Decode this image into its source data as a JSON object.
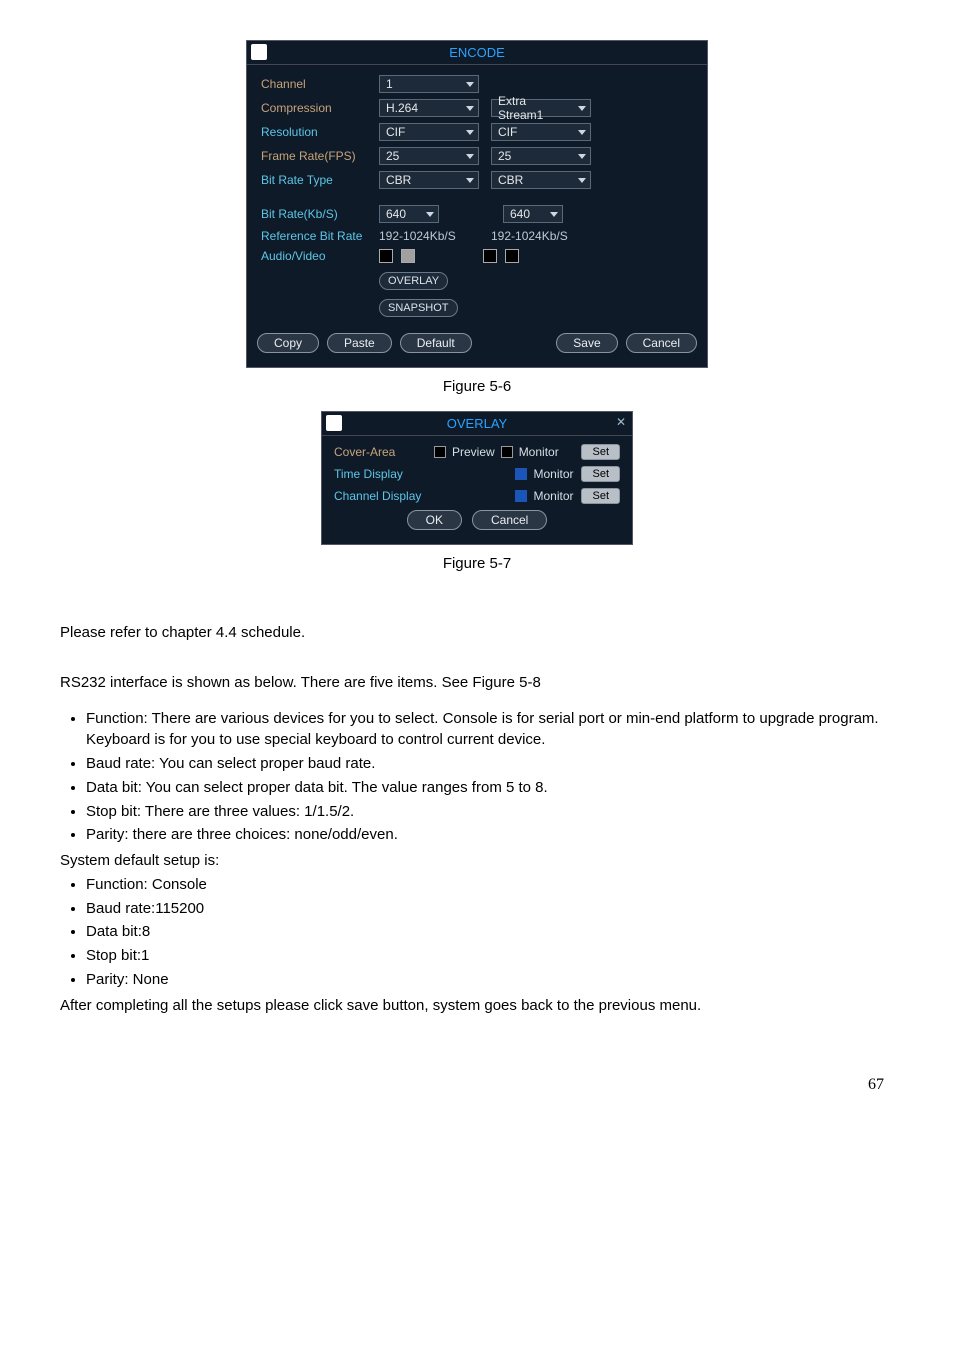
{
  "encode": {
    "title": "ENCODE",
    "labels": {
      "channel": "Channel",
      "compression": "Compression",
      "resolution": "Resolution",
      "fps": "Frame Rate(FPS)",
      "bitratetype": "Bit Rate Type",
      "bitrate": "Bit Rate(Kb/S)",
      "refbitrate": "Reference Bit Rate",
      "av": "Audio/Video"
    },
    "main": {
      "channel": "1",
      "compression": "H.264",
      "resolution": "CIF",
      "fps": "25",
      "bitratetype": "CBR",
      "bitrate": "640",
      "ref": "192-1024Kb/S"
    },
    "extra": {
      "stream": "Extra Stream1",
      "resolution": "CIF",
      "fps": "25",
      "bitratetype": "CBR",
      "bitrate": "640",
      "ref": "192-1024Kb/S"
    },
    "buttons": {
      "overlay": "OVERLAY",
      "snapshot": "SNAPSHOT",
      "copy": "Copy",
      "paste": "Paste",
      "default": "Default",
      "save": "Save",
      "cancel": "Cancel"
    }
  },
  "figA": "Figure 5-6",
  "overlay": {
    "title": "OVERLAY",
    "coverarea_label": "Cover-Area",
    "preview": "Preview",
    "monitor": "Monitor",
    "time_label": "Time Display",
    "channel_label": "Channel Display",
    "set": "Set",
    "ok": "OK",
    "cancel": "Cancel"
  },
  "figB": "Figure 5-7",
  "body": {
    "p1": "Please refer to chapter 4.4 schedule.",
    "p2": "RS232 interface is shown as below. There are five items. See Figure 5-8",
    "li_function": "Function: There are various devices for you to select. Console is for serial port or min-end platform to upgrade program. Keyboard is for you to use special keyboard to control current device.",
    "li_baud": "Baud rate: You can select proper baud rate.",
    "li_databit": "Data bit: You can select proper data bit. The value ranges from 5 to 8.",
    "li_stop": "Stop bit: There are three values: 1/1.5/2.",
    "li_parity": "Parity: there are three choices: none/odd/even.",
    "p3": "System default setup is:",
    "d_function": "Function: Console",
    "d_baud": "Baud rate:115200",
    "d_databit": "Data bit:8",
    "d_stop": "Stop bit:1",
    "d_parity": "Parity: None",
    "p4": "After completing all the setups please click save button, system goes back to the previous menu."
  },
  "page": "67"
}
